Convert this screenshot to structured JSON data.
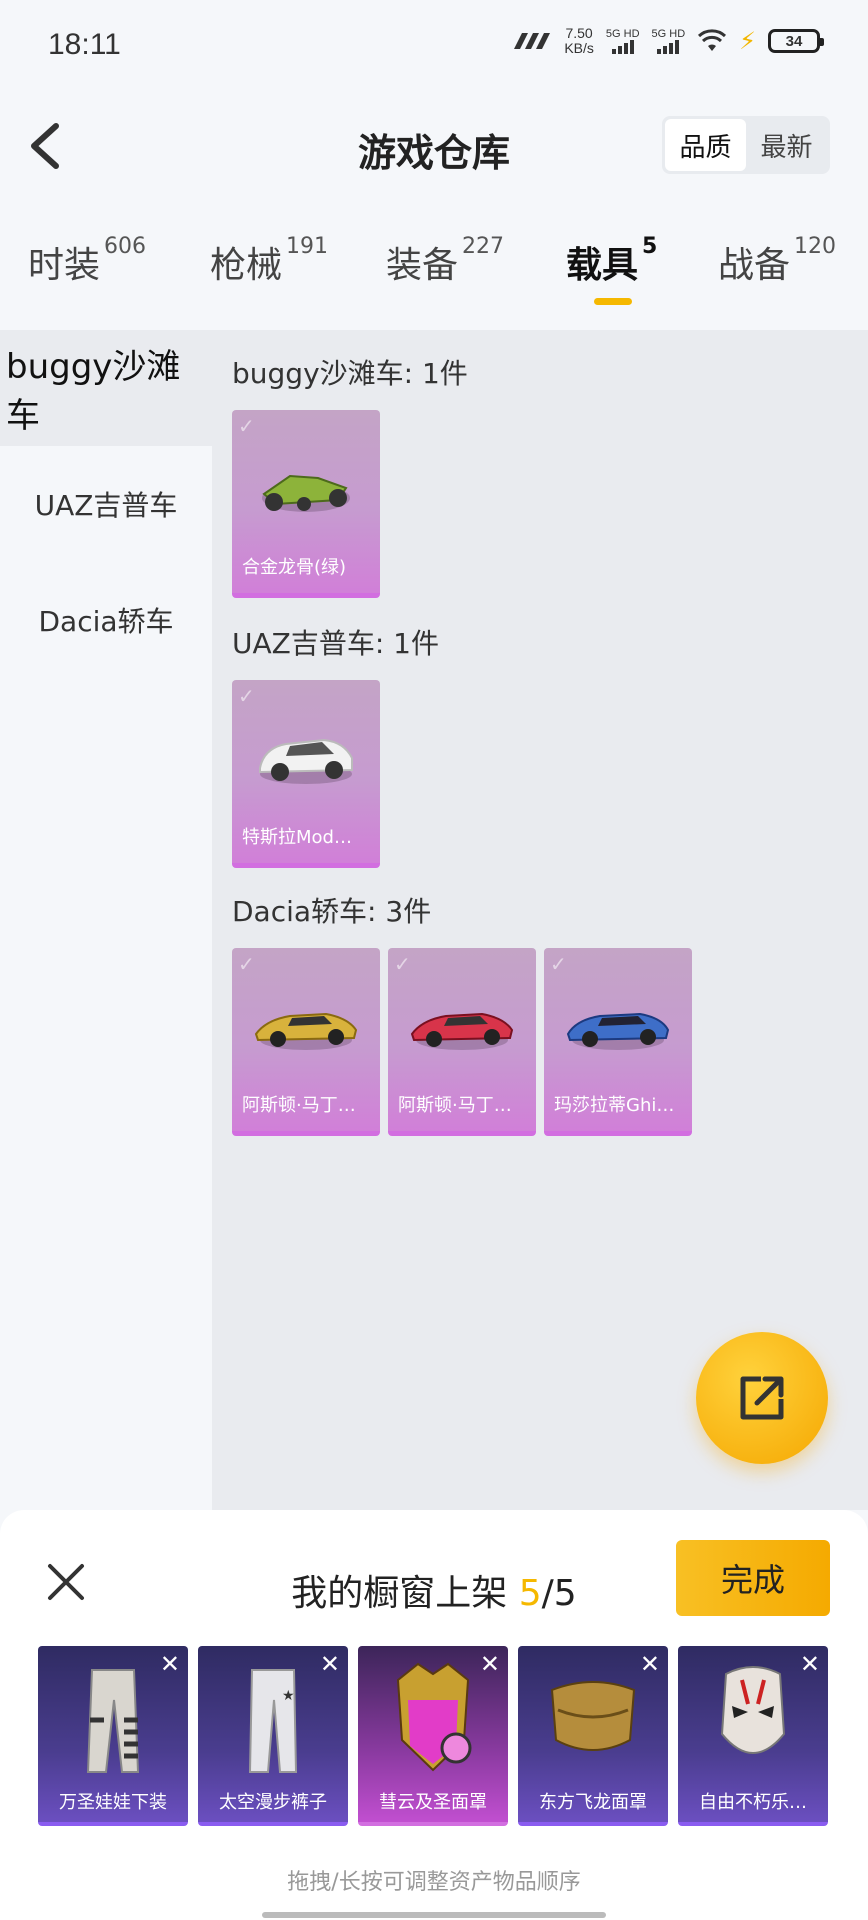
{
  "status_bar": {
    "time": "18:11",
    "net_speed_value": "7.50",
    "net_speed_unit": "KB/s",
    "sim1": "5G HD",
    "sim2": "5G HD",
    "battery": "34"
  },
  "header": {
    "title": "游戏仓库",
    "sort_options": [
      "品质",
      "最新"
    ],
    "active_sort": "品质"
  },
  "tabs": [
    {
      "label": "时装",
      "count": "606"
    },
    {
      "label": "枪械",
      "count": "191"
    },
    {
      "label": "装备",
      "count": "227"
    },
    {
      "label": "载具",
      "count": "5"
    },
    {
      "label": "战备",
      "count": "120"
    }
  ],
  "active_tab": "载具",
  "sidebar": {
    "items": [
      {
        "label": "buggy沙滩车"
      },
      {
        "label": "UAZ吉普车"
      },
      {
        "label": "Dacia轿车"
      }
    ],
    "active": "buggy沙滩车"
  },
  "groups": [
    {
      "title": "buggy沙滩车: 1件",
      "items": [
        {
          "name": "合金龙骨(绿)",
          "color": "#8db33a"
        }
      ]
    },
    {
      "title": "UAZ吉普车: 1件",
      "items": [
        {
          "name": "特斯拉Mod…",
          "color": "#f2f2f2"
        }
      ]
    },
    {
      "title": "Dacia轿车: 3件",
      "items": [
        {
          "name": "阿斯顿·马丁…",
          "color": "#d8b23c"
        },
        {
          "name": "阿斯顿·马丁…",
          "color": "#d8344a"
        },
        {
          "name": "玛莎拉蒂Ghi…",
          "color": "#3e6ec8"
        }
      ]
    }
  ],
  "panel": {
    "title_prefix": "我的橱窗上架",
    "count_current": "5",
    "count_total": "/5",
    "done_label": "完成",
    "hint": "拖拽/长按可调整资产物品顺序",
    "items": [
      {
        "name": "万圣娃娃下装",
        "icon": "pants-icon"
      },
      {
        "name": "太空漫步裤子",
        "icon": "pants-icon"
      },
      {
        "name": "彗云及圣面罩",
        "icon": "mask-icon"
      },
      {
        "name": "东方飞龙面罩",
        "icon": "scarf-icon"
      },
      {
        "name": "自由不朽乐…",
        "icon": "mask-icon"
      }
    ]
  },
  "colors": {
    "accent": "#f5b800",
    "card_purple": "#d26ee0",
    "background": "#e9ebef"
  }
}
